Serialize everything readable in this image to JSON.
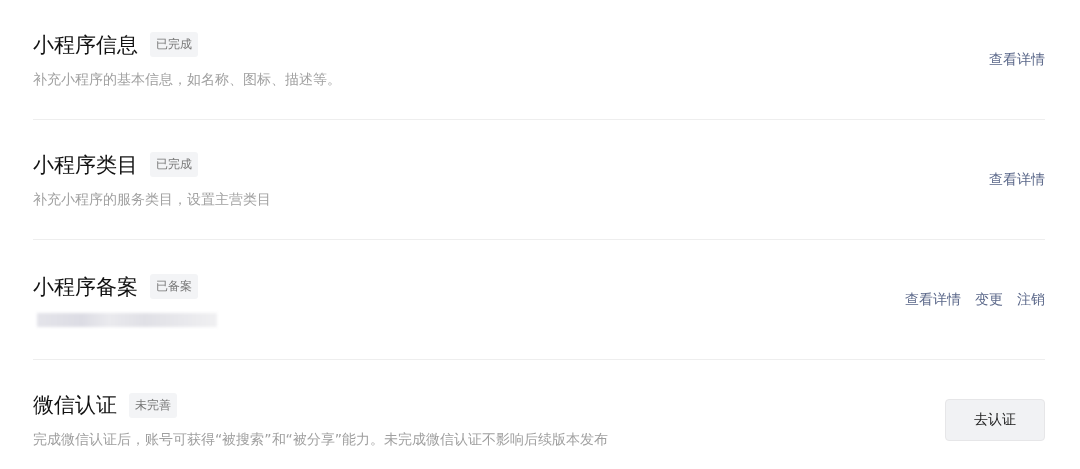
{
  "sections": [
    {
      "title": "小程序信息",
      "status": "已完成",
      "description": "补充小程序的基本信息，如名称、图标、描述等。",
      "redacted": false,
      "actions": [
        {
          "label": "查看详情",
          "kind": "link"
        }
      ]
    },
    {
      "title": "小程序类目",
      "status": "已完成",
      "description": "补充小程序的服务类目，设置主营类目",
      "redacted": false,
      "actions": [
        {
          "label": "查看详情",
          "kind": "link"
        }
      ]
    },
    {
      "title": "小程序备案",
      "status": "已备案",
      "redacted": true,
      "actions": [
        {
          "label": "查看详情",
          "kind": "link"
        },
        {
          "label": "变更",
          "kind": "link"
        },
        {
          "label": "注销",
          "kind": "link"
        }
      ]
    },
    {
      "title": "微信认证",
      "status": "未完善",
      "description": "完成微信认证后，账号可获得“被搜索”和“被分享”能力。未完成微信认证不影响后续版本发布",
      "redacted": false,
      "actions": [
        {
          "label": "去认证",
          "kind": "button"
        }
      ]
    }
  ]
}
